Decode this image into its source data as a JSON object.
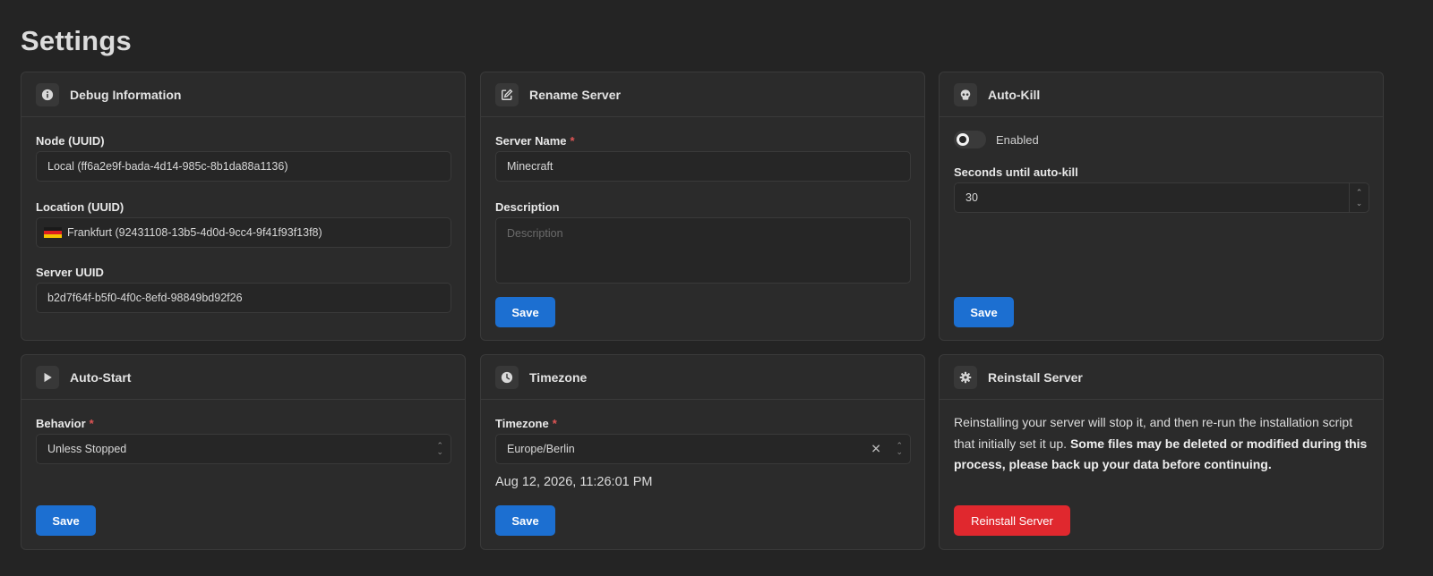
{
  "page": {
    "title": "Settings"
  },
  "debug": {
    "title": "Debug Information",
    "icon": "info-circle-icon",
    "node_label": "Node (UUID)",
    "node_value": "Local (ff6a2e9f-bada-4d14-985c-8b1da88a1136)",
    "location_label": "Location (UUID)",
    "location_value": "Frankfurt (92431108-13b5-4d0d-9cc4-9f41f93f13f8)",
    "location_flag": "germany-flag-icon",
    "server_uuid_label": "Server UUID",
    "server_uuid_value": "b2d7f64f-b5f0-4f0c-8efd-98849bd92f26"
  },
  "rename": {
    "title": "Rename Server",
    "icon": "edit-icon",
    "name_label": "Server Name",
    "required_mark": "*",
    "name_value": "Minecraft",
    "description_label": "Description",
    "description_placeholder": "Description",
    "save_label": "Save"
  },
  "autokill": {
    "title": "Auto-Kill",
    "icon": "skull-icon",
    "toggle_label": "Enabled",
    "toggle_on": false,
    "seconds_label": "Seconds until auto-kill",
    "seconds_value": "30",
    "save_label": "Save"
  },
  "autostart": {
    "title": "Auto-Start",
    "icon": "play-icon",
    "behavior_label": "Behavior",
    "required_mark": "*",
    "behavior_value": "Unless Stopped",
    "save_label": "Save"
  },
  "timezone": {
    "title": "Timezone",
    "icon": "clock-icon",
    "timezone_label": "Timezone",
    "required_mark": "*",
    "timezone_value": "Europe/Berlin",
    "current_time": "Aug 12, 2026, 11:26:01 PM",
    "save_label": "Save"
  },
  "reinstall": {
    "title": "Reinstall Server",
    "icon": "gear-icon",
    "description_plain": "Reinstalling your server will stop it, and then re-run the installation script that initially set it up. ",
    "description_bold": "Some files may be deleted or modified during this process, please back up your data before continuing.",
    "button_label": "Reinstall Server"
  },
  "colors": {
    "background": "#242424",
    "card": "#2b2b2b",
    "primary_button": "#1c6fd1",
    "danger_button": "#e0282e",
    "required": "#e05555"
  }
}
